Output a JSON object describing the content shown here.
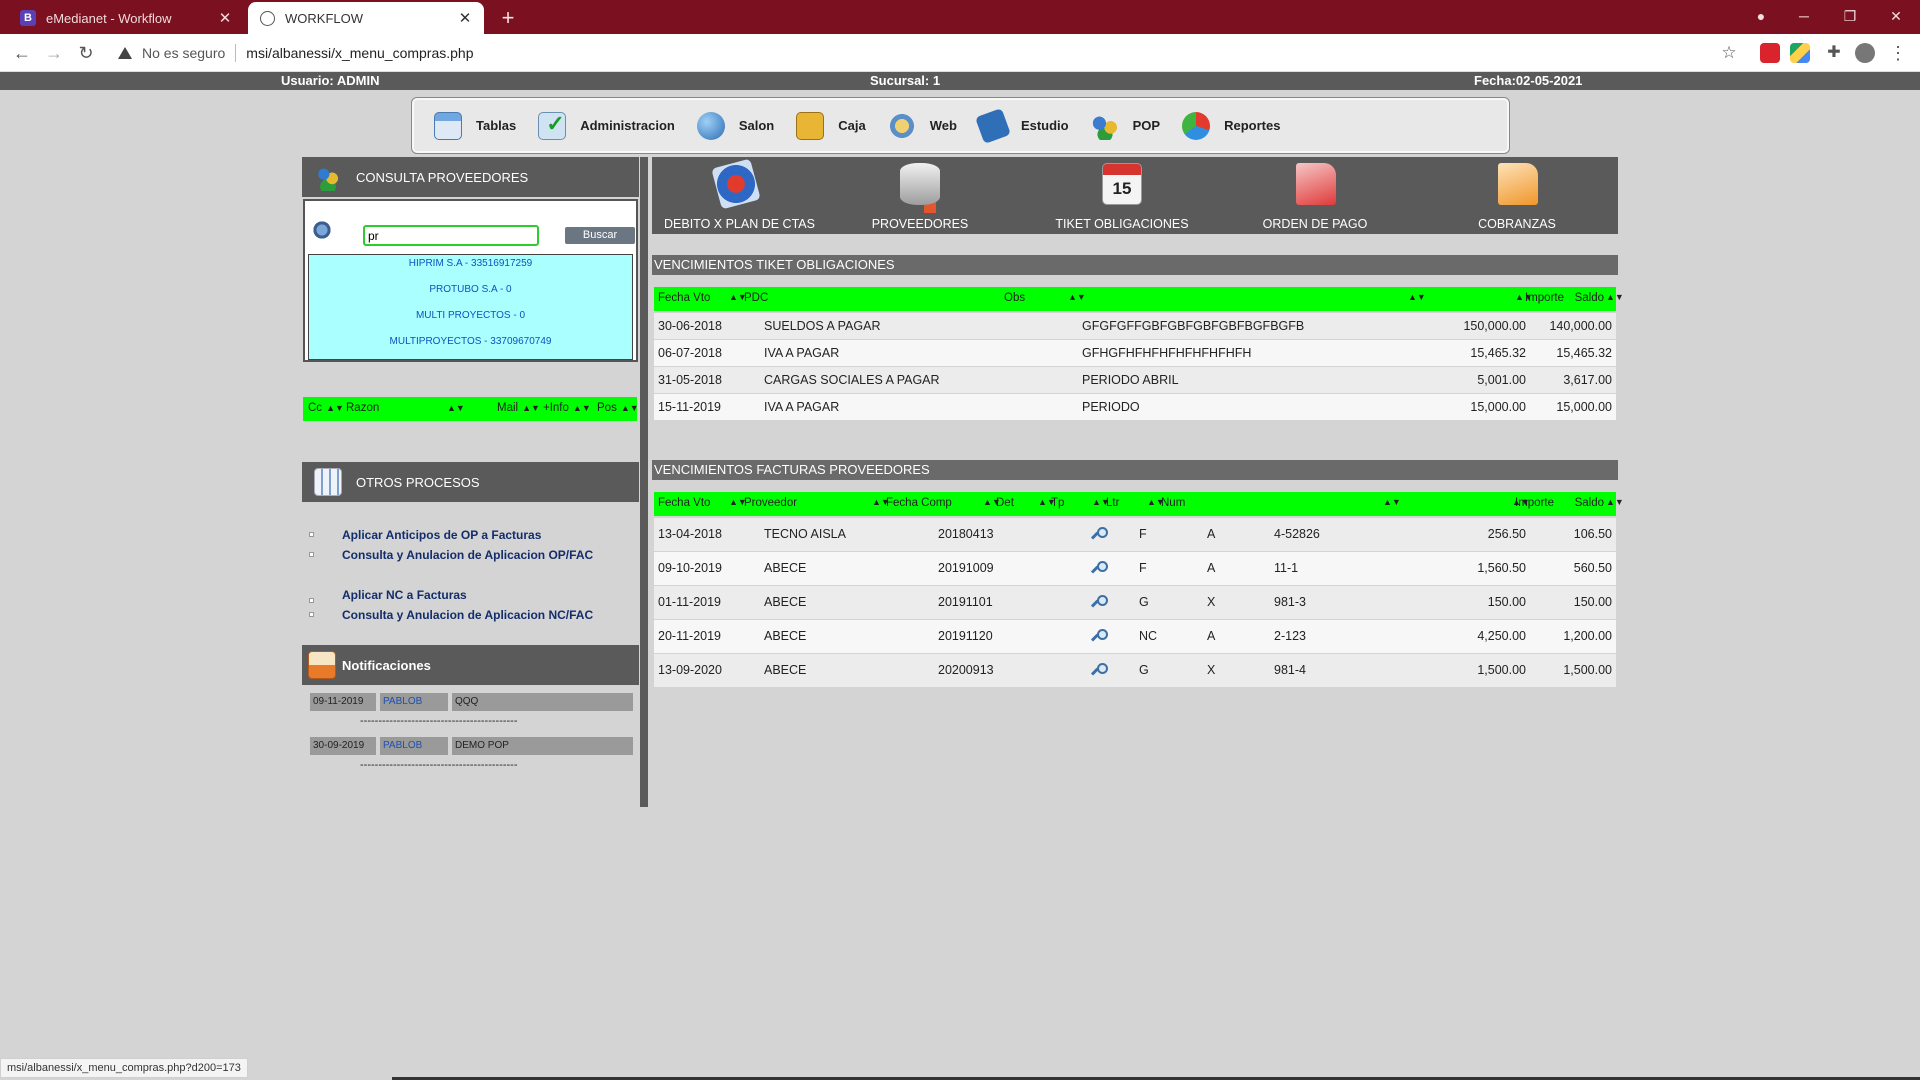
{
  "browser": {
    "tabs": [
      {
        "title": "eMedianet - Workflow",
        "favicon": "B",
        "active": false
      },
      {
        "title": "WORKFLOW",
        "active": true
      }
    ],
    "security_label": "No es seguro",
    "url": "msi/albanessi/x_menu_compras.php",
    "status_url": "msi/albanessi/x_menu_compras.php?d200=173"
  },
  "infobar": {
    "usuario": "Usuario: ADMIN",
    "sucursal": "Sucursal: 1",
    "fecha": "Fecha:02-05-2021"
  },
  "topnav": [
    {
      "label": "Tablas",
      "icon": "table-icon"
    },
    {
      "label": "Administracion",
      "icon": "checklist-icon"
    },
    {
      "label": "Salon",
      "icon": "globe-icon"
    },
    {
      "label": "Caja",
      "icon": "cash-icon"
    },
    {
      "label": "Web",
      "icon": "web-icon"
    },
    {
      "label": "Estudio",
      "icon": "book-icon"
    },
    {
      "label": "POP",
      "icon": "users-icon"
    },
    {
      "label": "Reportes",
      "icon": "pie-chart-icon"
    }
  ],
  "consulta": {
    "title": "CONSULTA PROVEEDORES",
    "search_value": "pr",
    "search_button": "Buscar",
    "results": [
      "HIPRIM S.A - 33516917259",
      "PROTUBO S.A - 0",
      "MULTI PROYECTOS - 0",
      "MULTIPROYECTOS - 33709670749"
    ],
    "columns": [
      "Cc",
      "Razon",
      "Mail",
      "+Info",
      "Pos"
    ]
  },
  "otros": {
    "title": "OTROS PROCESOS",
    "links": [
      "Aplicar Anticipos de OP a Facturas",
      "Consulta y Anulacion de Aplicacion OP/FAC",
      "Aplicar NC a Facturas",
      "Consulta y Anulacion de Aplicacion NC/FAC"
    ]
  },
  "notificaciones": {
    "title": "Notificaciones",
    "items": [
      {
        "fecha": "09-11-2019",
        "usuario": "PABLOB",
        "texto": "QQQ"
      },
      {
        "fecha": "30-09-2019",
        "usuario": "PABLOB",
        "texto": "DEMO POP"
      }
    ],
    "separator": "-------------------------------------------"
  },
  "menu_options": [
    {
      "label": "DEBITO X PLAN DE CTAS",
      "icon": "debit-icon"
    },
    {
      "label": "PROVEEDORES",
      "icon": "database-icon"
    },
    {
      "label": "TIKET OBLIGACIONES",
      "icon": "calendar-icon",
      "icon_text": "15"
    },
    {
      "label": "ORDEN DE PAGO",
      "icon": "document-red-icon"
    },
    {
      "label": "COBRANZAS",
      "icon": "document-orange-icon"
    }
  ],
  "tiket": {
    "title": "VENCIMIENTOS TIKET OBLIGACIONES",
    "columns": [
      "Fecha Vto",
      "PDC",
      "Obs",
      "Importe",
      "Saldo"
    ],
    "rows": [
      [
        "30-06-2018",
        "SUELDOS A PAGAR",
        "GFGFGFFGBFGBFGBFGBFBGFBGFB",
        "150,000.00",
        "140,000.00"
      ],
      [
        "06-07-2018",
        "IVA A PAGAR",
        "GFHGFHFHFHFHFHFHFHFH",
        "15,465.32",
        "15,465.32"
      ],
      [
        "31-05-2018",
        "CARGAS SOCIALES A PAGAR",
        "PERIODO ABRIL",
        "5,001.00",
        "3,617.00"
      ],
      [
        "15-11-2019",
        "IVA A PAGAR",
        "PERIODO",
        "15,000.00",
        "15,000.00"
      ]
    ]
  },
  "facturas": {
    "title": "VENCIMIENTOS FACTURAS PROVEEDORES",
    "columns": [
      "Fecha Vto",
      "Proveedor",
      "Fecha Comp",
      "Det",
      "Tp",
      "Ltr",
      "Num",
      "Importe",
      "Saldo"
    ],
    "rows": [
      [
        "13-04-2018",
        "TECNO AISLA",
        "20180413",
        "F",
        "A",
        "4-52826",
        "256.50",
        "106.50"
      ],
      [
        "09-10-2019",
        "ABECE",
        "20191009",
        "F",
        "A",
        "11-1",
        "1,560.50",
        "560.50"
      ],
      [
        "01-11-2019",
        "ABECE",
        "20191101",
        "G",
        "X",
        "981-3",
        "150.00",
        "150.00"
      ],
      [
        "20-11-2019",
        "ABECE",
        "20191120",
        "NC",
        "A",
        "2-123",
        "4,250.00",
        "1,200.00"
      ],
      [
        "13-09-2020",
        "ABECE",
        "20200913",
        "G",
        "X",
        "981-4",
        "1,500.00",
        "1,500.00"
      ]
    ]
  }
}
